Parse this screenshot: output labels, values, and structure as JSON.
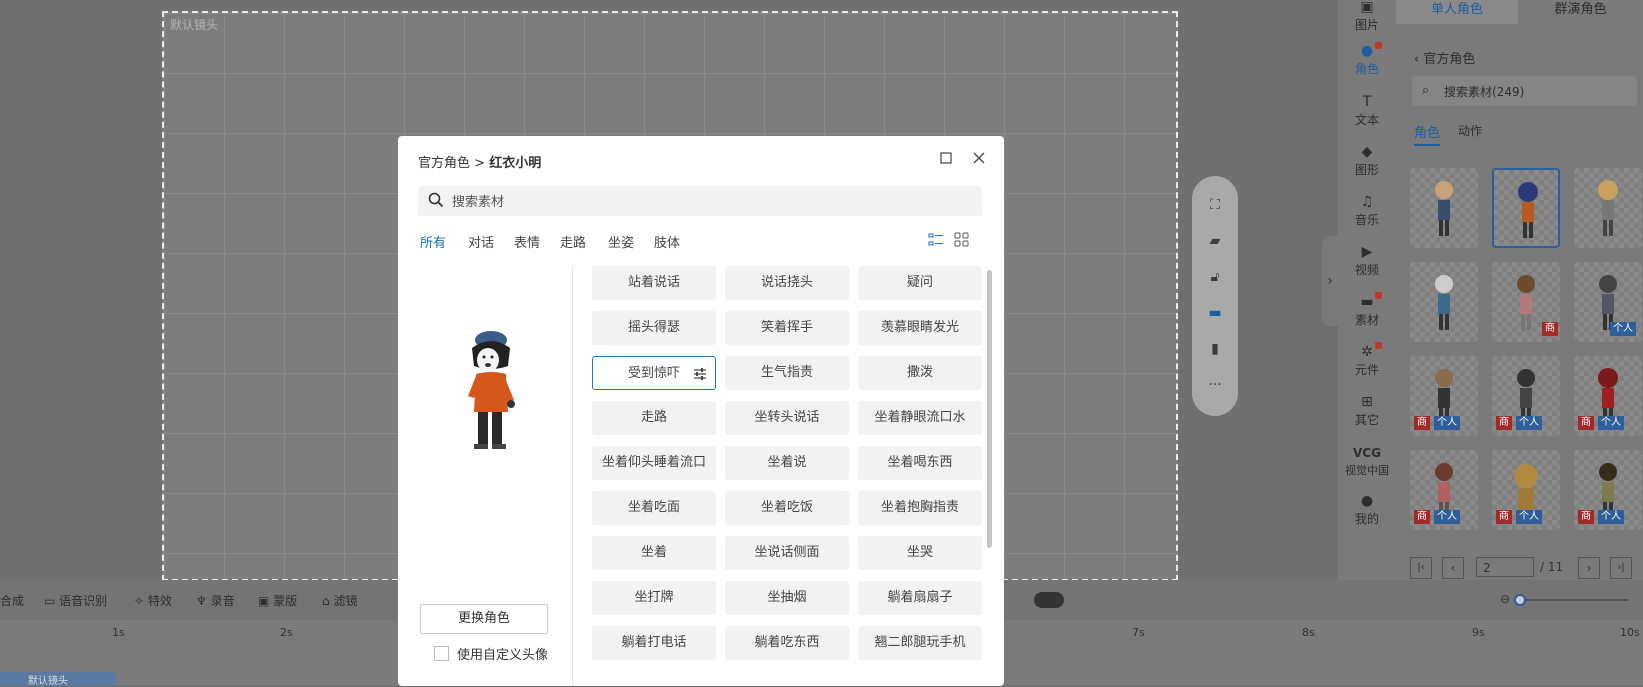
{
  "stage": {
    "label": "默认镜头"
  },
  "dialog": {
    "breadcrumb_root": "官方角色",
    "breadcrumb_sep": ">",
    "breadcrumb_current": "红衣小明",
    "search_placeholder": "搜索素材",
    "filters": [
      "所有",
      "对话",
      "表情",
      "走路",
      "坐姿",
      "肢体"
    ],
    "actions": [
      "站着说话",
      "说话挠头",
      "疑问",
      "摇头得瑟",
      "笑着挥手",
      "羡慕眼睛发光",
      "受到惊吓",
      "生气指责",
      "撒泼",
      "走路",
      "坐转头说话",
      "坐着静眼流口水",
      "坐着仰头睡着流口",
      "坐着说",
      "坐着喝东西",
      "坐着吃面",
      "坐着吃饭",
      "坐着抱胸指责",
      "坐着",
      "坐说话侧面",
      "坐哭",
      "坐打牌",
      "坐抽烟",
      "躺着扇扇子",
      "躺着打电话",
      "躺着吃东西",
      "翘二郎腿玩手机"
    ],
    "change_role_label": "更换角色",
    "custom_avatar_label": "使用自定义头像"
  },
  "side_nav": [
    {
      "label": "图片",
      "icon": "image-icon"
    },
    {
      "label": "角色",
      "icon": "person-icon"
    },
    {
      "label": "文本",
      "icon": "text-icon"
    },
    {
      "label": "图形",
      "icon": "shape-icon"
    },
    {
      "label": "音乐",
      "icon": "music-icon"
    },
    {
      "label": "视频",
      "icon": "video-icon"
    },
    {
      "label": "素材",
      "icon": "folder-icon"
    },
    {
      "label": "元件",
      "icon": "component-icon"
    },
    {
      "label": "其它",
      "icon": "grid-icon"
    },
    {
      "label": "VCG",
      "icon": "vcg-logo"
    },
    {
      "label": "视觉中国",
      "icon": "none"
    },
    {
      "label": "我的",
      "icon": "user-icon"
    }
  ],
  "side_panel": {
    "tabs": [
      "单人角色",
      "群演角色"
    ],
    "back_label": "官方角色",
    "search_placeholder": "搜索素材(249)",
    "sub_tabs": [
      "角色",
      "动作"
    ],
    "badge_shang": "商",
    "badge_geren": "个人",
    "page_current": "2",
    "page_total": "/ 11"
  },
  "bottom_toolbar": [
    "合成",
    "语音识别",
    "特效",
    "录音",
    "蒙版",
    "滤镜"
  ],
  "timeline": {
    "ticks": [
      "1s",
      "2s",
      "7s",
      "8s",
      "9s",
      "10s"
    ],
    "track_label": "默认镜头"
  },
  "colors": {
    "accent": "#1d6fb3",
    "overlay": "#6b6b6b",
    "badge_red": "#a12a2a",
    "badge_blue": "#2f5f9b"
  }
}
